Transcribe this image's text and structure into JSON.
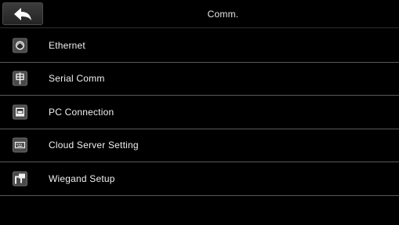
{
  "header": {
    "title": "Comm.",
    "back_icon": "back-arrow-icon"
  },
  "menu": {
    "items": [
      {
        "label": "Ethernet",
        "icon": "ethernet-icon"
      },
      {
        "label": "Serial Comm",
        "icon": "serial-comm-icon"
      },
      {
        "label": "PC Connection",
        "icon": "pc-connection-icon"
      },
      {
        "label": "Cloud Server Setting",
        "icon": "cloud-server-icon"
      },
      {
        "label": "Wiegand Setup",
        "icon": "wiegand-icon"
      }
    ]
  },
  "colors": {
    "background": "#000000",
    "text": "#f0f0f0",
    "divider": "#5a5a5a",
    "icon_tile": "#4a4a4a"
  }
}
